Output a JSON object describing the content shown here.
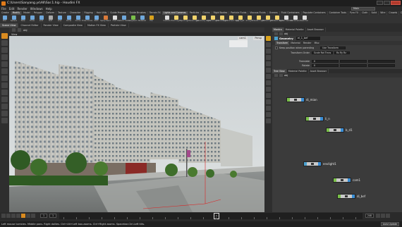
{
  "window": {
    "title": "C:\\Users\\Sanyang.ys\\All\\Sar.1.hip - Houdini FX",
    "desktop": "Main"
  },
  "menu": [
    "File",
    "Edit",
    "Render",
    "Windows",
    "Help"
  ],
  "shelf_tabs_left": [
    "Create",
    "Modify",
    "Model",
    "Polygon",
    "Deform",
    "Texture",
    "Character",
    "Rigging",
    "Hair Utils",
    "Guide Process",
    "Guide Brushes",
    "Terrain FX",
    "Volume",
    "+"
  ],
  "shelf_tabs_right": [
    "Lights and Cameras",
    "Particles",
    "Grains",
    "Rigid Bodies",
    "Particle Fluids",
    "Viscous Fluids",
    "Oceans",
    "Fluid Containers",
    "Populate Containers",
    "Container Tools",
    "Pyro FX",
    "Cloth",
    "Solid",
    "Wire",
    "Crowds",
    "Drive Simulation"
  ],
  "shelf_tools_left": [
    {
      "label": "Box",
      "color": "#6fa8dc"
    },
    {
      "label": "Sphere",
      "color": "#6fa8dc"
    },
    {
      "label": "Tube",
      "color": "#6fa8dc"
    },
    {
      "label": "Torus",
      "color": "#6fa8dc"
    },
    {
      "label": "Grid",
      "color": "#6fa8dc"
    },
    {
      "label": "Null",
      "color": "#aaaaaa"
    },
    {
      "label": "Line",
      "color": "#6fa8dc"
    },
    {
      "label": "Circle",
      "color": "#6fa8dc"
    },
    {
      "label": "Curve",
      "color": "#6fa8dc"
    },
    {
      "label": "Draw Curve",
      "color": "#6fa8dc"
    },
    {
      "label": "Path",
      "color": "#6fa8dc"
    },
    {
      "label": "Spray Paint",
      "color": "#d97a3a"
    },
    {
      "label": "Font",
      "color": "#dddddd"
    },
    {
      "label": "Platonic Solids",
      "color": "#6fa8dc"
    },
    {
      "label": "L-System",
      "color": "#7ac04a"
    },
    {
      "label": "Metaball",
      "color": "#6fa8dc"
    },
    {
      "label": "File",
      "color": "#d9a21c"
    }
  ],
  "shelf_tools_right": [
    {
      "label": "Camera",
      "color": "#dddddd"
    },
    {
      "label": "Point Light",
      "color": "#f1d36b"
    },
    {
      "label": "Spot Light",
      "color": "#f1d36b"
    },
    {
      "label": "Area Light",
      "color": "#f1d36b"
    },
    {
      "label": "Geometry Light",
      "color": "#f1d36b"
    },
    {
      "label": "Volume Light",
      "color": "#f1d36b"
    },
    {
      "label": "Distant Light",
      "color": "#f1d36b"
    },
    {
      "label": "Environment Light",
      "color": "#f1d36b"
    },
    {
      "label": "Sky Light",
      "color": "#f1d36b"
    },
    {
      "label": "GI Light",
      "color": "#f1d36b"
    },
    {
      "label": "Caustic Light",
      "color": "#f1d36b"
    },
    {
      "label": "Portal Light",
      "color": "#f1d36b"
    },
    {
      "label": "Ambient Light",
      "color": "#f1d36b"
    },
    {
      "label": "Stereo Camera",
      "color": "#dddddd"
    },
    {
      "label": "VR Camera",
      "color": "#dddddd"
    },
    {
      "label": "Switcher",
      "color": "#dddddd"
    }
  ],
  "desktop_tabs": [
    "Scene View",
    "Channel Editor",
    "Render View",
    "Composite View",
    "Motion FX View",
    "Particle View"
  ],
  "viewer": {
    "path_label": "obj",
    "pane_label": "View",
    "camera_label": "cam1",
    "perspective_label": "Persp"
  },
  "param_tabs": [
    "Mantra",
    "Material Palette",
    "Asset Browser"
  ],
  "param": {
    "path_label": "obj",
    "header_label": "Geometry",
    "node_name": "el_1_bef",
    "subtabs": [
      "Transform",
      "Material",
      "Render",
      "Misc"
    ],
    "rows": [
      {
        "label": "Keep position when parenting",
        "value": "Use Transform"
      },
      {
        "label": "Transform Order",
        "value": "Scale Rot Trans"
      },
      {
        "label": "Translate",
        "value": "0"
      },
      {
        "label": "Rotate",
        "value": "0"
      }
    ],
    "transform_extra": "Rx Ry Rz"
  },
  "network_tabs": [
    "Tree View",
    "Material Palette",
    "Asset Browser"
  ],
  "network_path": "obj",
  "nodes": [
    {
      "label": "di_mian"
    },
    {
      "label": "li_n"
    },
    {
      "label": "b_d1"
    },
    {
      "label": "envlight1"
    },
    {
      "label": "cam1"
    },
    {
      "label": "di_bef"
    }
  ],
  "timeline": {
    "current_frame": "1",
    "start_frame": "1",
    "end_frame": "240",
    "marker_label": "1"
  },
  "status": {
    "text": "Left mouse tumbles. Middle pans. Right dollies. Ctrl+Alt+Left box-zooms. Ctrl+Right zooms. Spacebar-Ctrl-Left tilts.",
    "auto_update": "Auto Update"
  }
}
